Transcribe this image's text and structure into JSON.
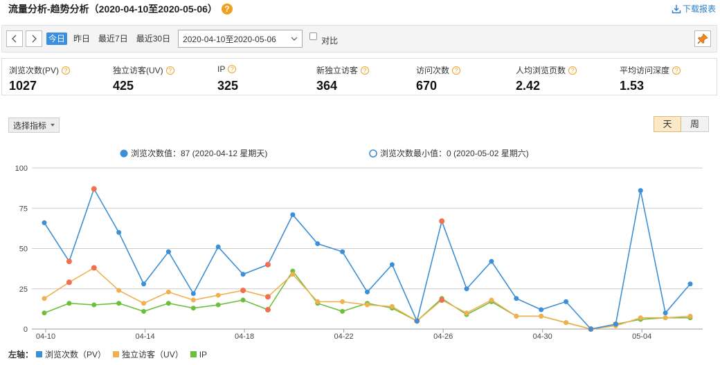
{
  "header": {
    "title": "流量分析-趋势分析（2020-04-10至2020-05-06）",
    "help": "?",
    "download_label": "下载报表"
  },
  "toolbar": {
    "ranges": [
      "今日",
      "昨日",
      "最近7日",
      "最近30日"
    ],
    "active_range": "今日",
    "date_range": "2020-04-10至2020-05-06",
    "compare_label": "对比"
  },
  "metrics": [
    {
      "label": "浏览次数(PV)",
      "value": "1027"
    },
    {
      "label": "独立访客(UV)",
      "value": "425"
    },
    {
      "label": "IP",
      "value": "325"
    },
    {
      "label": "新独立访客",
      "value": "364"
    },
    {
      "label": "访问次数",
      "value": "670"
    },
    {
      "label": "人均浏览页数",
      "value": "2.42"
    },
    {
      "label": "平均访问深度",
      "value": "1.53"
    }
  ],
  "controls": {
    "select_metric_label": "选择指标",
    "period_day": "天",
    "period_week": "周"
  },
  "chart_legend": {
    "max_label": "浏览次数值：87 (2020-04-12 星期天)",
    "min_label": "浏览次数最小值：0 (2020-05-02 星期六)"
  },
  "bottom_legend": {
    "axis_label": "左轴：",
    "items": [
      "浏览次数（PV）",
      "独立访客（UV）",
      "IP"
    ]
  },
  "colors": {
    "pv": "#3a8fd6",
    "uv": "#f0b050",
    "ip": "#6cbf3c",
    "highlight": "#f07050",
    "accent": "#3b8fdd"
  },
  "chart_data": {
    "type": "line",
    "x": [
      "04-10",
      "04-11",
      "04-12",
      "04-13",
      "04-14",
      "04-15",
      "04-16",
      "04-17",
      "04-18",
      "04-19",
      "04-20",
      "04-21",
      "04-22",
      "04-23",
      "04-24",
      "04-25",
      "04-26",
      "04-27",
      "04-28",
      "04-29",
      "04-30",
      "05-01",
      "05-02",
      "05-03",
      "05-04",
      "05-05",
      "05-06"
    ],
    "xticks": [
      "04-10",
      "04-14",
      "04-18",
      "04-22",
      "04-26",
      "04-30",
      "05-04"
    ],
    "ylim": [
      0,
      100
    ],
    "yticks": [
      0,
      25,
      50,
      75,
      100
    ],
    "series": [
      {
        "name": "浏览次数（PV）",
        "color": "#3a8fd6",
        "values": [
          66,
          42,
          87,
          60,
          28,
          48,
          22,
          51,
          34,
          40,
          71,
          53,
          48,
          23,
          40,
          5,
          67,
          25,
          42,
          19,
          12,
          17,
          0,
          3,
          86,
          10,
          28
        ]
      },
      {
        "name": "独立访客（UV）",
        "color": "#f0b050",
        "values": [
          19,
          29,
          38,
          24,
          16,
          23,
          18,
          21,
          24,
          20,
          34,
          17,
          17,
          15,
          14,
          5,
          18,
          10,
          18,
          8,
          8,
          4,
          0,
          2,
          7,
          7,
          8
        ]
      },
      {
        "name": "IP",
        "color": "#6cbf3c",
        "values": [
          10,
          16,
          15,
          16,
          11,
          16,
          13,
          15,
          18,
          12,
          36,
          16,
          11,
          16,
          13,
          5,
          19,
          9,
          17,
          8,
          8,
          4,
          0,
          3,
          6,
          7,
          7
        ]
      }
    ],
    "highlight_points": [
      {
        "x": "04-11",
        "series": 0
      },
      {
        "x": "04-12",
        "series": 0
      },
      {
        "x": "04-19",
        "series": 0
      },
      {
        "x": "04-26",
        "series": 0
      },
      {
        "x": "04-11",
        "series": 1
      },
      {
        "x": "04-12",
        "series": 1
      },
      {
        "x": "04-18",
        "series": 1
      },
      {
        "x": "04-19",
        "series": 1
      },
      {
        "x": "04-26",
        "series": 1
      },
      {
        "x": "04-19",
        "series": 2
      },
      {
        "x": "04-25",
        "series": 2
      },
      {
        "x": "05-02",
        "series": 2
      },
      {
        "x": "05-03",
        "series": 2
      }
    ]
  }
}
